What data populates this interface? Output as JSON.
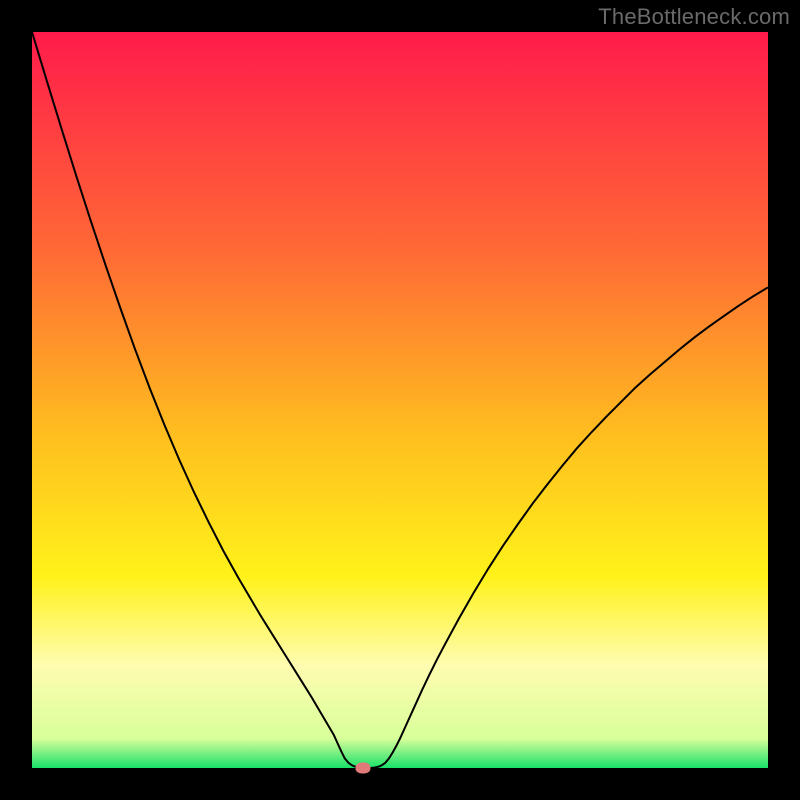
{
  "watermark": {
    "text": "TheBottleneck.com"
  },
  "chart_data": {
    "type": "line",
    "title": "",
    "xlabel": "",
    "ylabel": "",
    "xlim": [
      0,
      100
    ],
    "ylim": [
      0,
      100
    ],
    "gradient": [
      {
        "at": 0,
        "color": "#ff1b4b"
      },
      {
        "at": 30,
        "color": "#ff6a35"
      },
      {
        "at": 55,
        "color": "#ffbf1f"
      },
      {
        "at": 74,
        "color": "#fff21a"
      },
      {
        "at": 86,
        "color": "#fffcb0"
      },
      {
        "at": 96,
        "color": "#d8ff9a"
      },
      {
        "at": 100,
        "color": "#18e06a"
      }
    ],
    "curve_color": "#000000",
    "curve_width": 2,
    "dot_color": "#e07a78",
    "series": [
      {
        "name": "bottleneck-curve",
        "x_y_pairs": [
          [
            0,
            100
          ],
          [
            2,
            93.4
          ],
          [
            4,
            86.9
          ],
          [
            6,
            80.5
          ],
          [
            8,
            74.3
          ],
          [
            10,
            68.3
          ],
          [
            12,
            62.5
          ],
          [
            14,
            56.9
          ],
          [
            16,
            51.6
          ],
          [
            18,
            46.6
          ],
          [
            20,
            41.9
          ],
          [
            22,
            37.5
          ],
          [
            24,
            33.4
          ],
          [
            26,
            29.5
          ],
          [
            28,
            25.9
          ],
          [
            30,
            22.5
          ],
          [
            31,
            20.8
          ],
          [
            32,
            19.2
          ],
          [
            33,
            17.6
          ],
          [
            34,
            16.0
          ],
          [
            35,
            14.4
          ],
          [
            36,
            12.8
          ],
          [
            37,
            11.2
          ],
          [
            38,
            9.6
          ],
          [
            39,
            7.9
          ],
          [
            40,
            6.2
          ],
          [
            41,
            4.5
          ],
          [
            41.5,
            3.4
          ],
          [
            42,
            2.3
          ],
          [
            42.5,
            1.3
          ],
          [
            43,
            0.7
          ],
          [
            43.5,
            0.35
          ],
          [
            44,
            0.15
          ],
          [
            44.5,
            0.05
          ],
          [
            45,
            0
          ],
          [
            45.5,
            0
          ],
          [
            46,
            0
          ],
          [
            46.5,
            0.05
          ],
          [
            47,
            0.15
          ],
          [
            47.5,
            0.35
          ],
          [
            48,
            0.7
          ],
          [
            48.5,
            1.3
          ],
          [
            49,
            2.1
          ],
          [
            49.5,
            3.0
          ],
          [
            50,
            4.0
          ],
          [
            51,
            6.2
          ],
          [
            52,
            8.4
          ],
          [
            53,
            10.6
          ],
          [
            54,
            12.7
          ],
          [
            55,
            14.7
          ],
          [
            56,
            16.6
          ],
          [
            58,
            20.3
          ],
          [
            60,
            23.8
          ],
          [
            62,
            27.1
          ],
          [
            64,
            30.2
          ],
          [
            66,
            33.1
          ],
          [
            68,
            35.9
          ],
          [
            70,
            38.5
          ],
          [
            72,
            41.0
          ],
          [
            74,
            43.4
          ],
          [
            76,
            45.6
          ],
          [
            78,
            47.7
          ],
          [
            80,
            49.7
          ],
          [
            82,
            51.7
          ],
          [
            84,
            53.5
          ],
          [
            86,
            55.2
          ],
          [
            88,
            56.9
          ],
          [
            90,
            58.5
          ],
          [
            92,
            60.0
          ],
          [
            94,
            61.4
          ],
          [
            96,
            62.8
          ],
          [
            98,
            64.1
          ],
          [
            100,
            65.3
          ]
        ]
      }
    ],
    "min_point": {
      "x": 45,
      "y": 0
    }
  }
}
